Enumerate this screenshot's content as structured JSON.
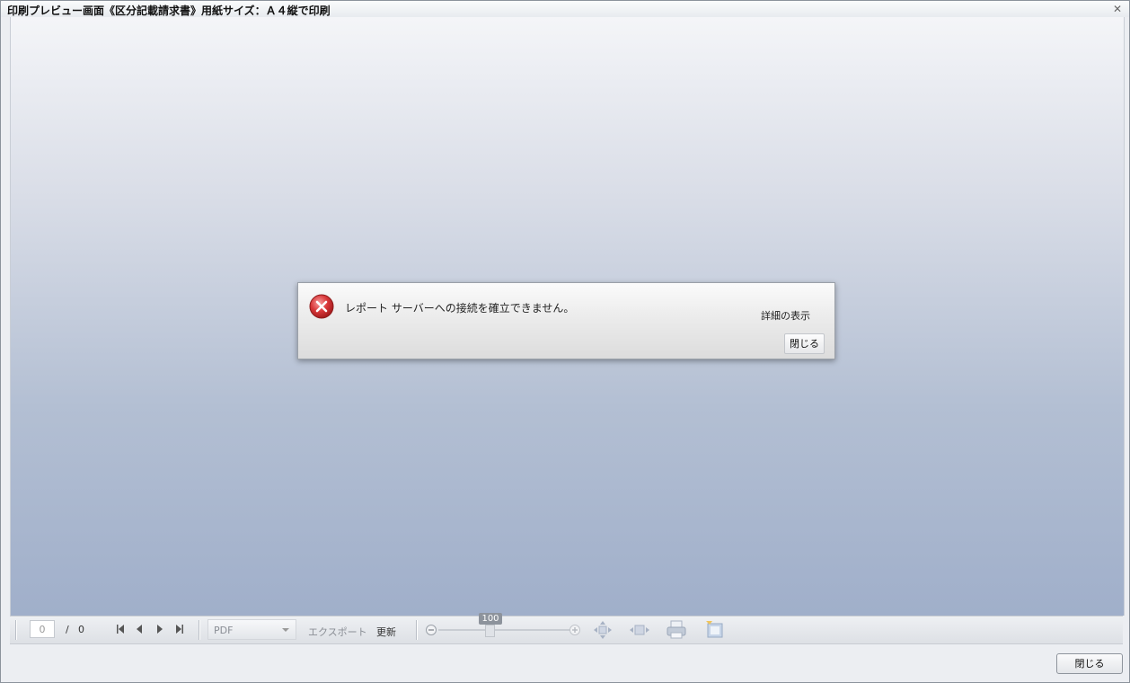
{
  "window": {
    "title": "印刷プレビュー画面《区分記載請求書》用紙サイズ：Ａ４縦で印刷",
    "close_glyph": "✕"
  },
  "toolbar": {
    "page_current": "0",
    "page_separator": "/",
    "page_total": "0",
    "nav_icons": [
      "first-page-icon",
      "previous-page-icon",
      "next-page-icon",
      "last-page-icon"
    ],
    "export_format": "PDF",
    "export_label": "エクスポート",
    "refresh_label": "更新",
    "zoom_value": "100",
    "tool_icons": [
      "zoom-in-icon",
      "fit-page-icon",
      "fit-width-icon",
      "print-icon",
      "print-layout-icon"
    ]
  },
  "dialog": {
    "message": "レポート サーバーへの接続を確立できません。",
    "details_label": "詳細の表示",
    "close_label": "閉じる",
    "icon": "error-icon"
  },
  "footer": {
    "close_label": "閉じる"
  },
  "colors": {
    "error_red": "#d9383a",
    "viewer_top": "#f4f5f8",
    "viewer_bottom": "#a0afca"
  }
}
